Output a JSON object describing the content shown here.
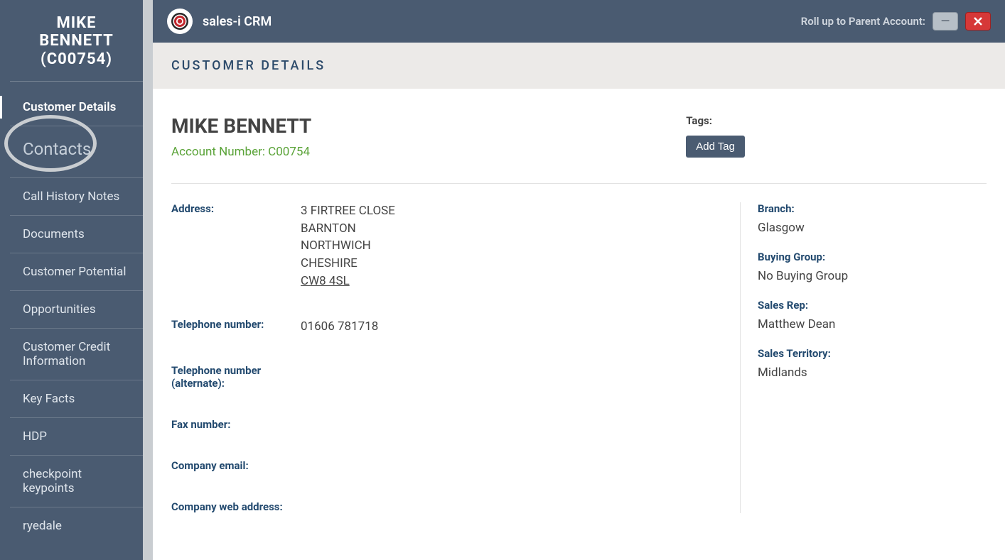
{
  "sidebar": {
    "title_line1": "MIKE",
    "title_line2": "BENNETT",
    "title_line3": "(C00754)",
    "items": [
      {
        "label": "Customer Details"
      },
      {
        "label": "Contacts"
      },
      {
        "label": "Call History Notes"
      },
      {
        "label": "Documents"
      },
      {
        "label": "Customer Potential"
      },
      {
        "label": "Opportunities"
      },
      {
        "label": "Customer Credit Information"
      },
      {
        "label": "Key Facts"
      },
      {
        "label": "HDP"
      },
      {
        "label": "checkpoint keypoints"
      },
      {
        "label": "ryedale"
      }
    ]
  },
  "topbar": {
    "app_title": "sales-i CRM",
    "rollup_label": "Roll up to Parent Account:"
  },
  "subheader": "CUSTOMER DETAILS",
  "customer": {
    "name": "MIKE BENNETT",
    "account_number_label": "Account Number: C00754",
    "tags_label": "Tags:",
    "add_tag_label": "Add Tag",
    "fields": {
      "address_label": "Address:",
      "address_line1": "3 FIRTREE CLOSE",
      "address_line2": "BARNTON",
      "address_line3": "NORTHWICH",
      "address_line4": "CHESHIRE",
      "address_postal": "CW8 4SL",
      "phone_label": "Telephone number:",
      "phone_value": "01606 781718",
      "phone_alt_label": "Telephone number (alternate):",
      "phone_alt_value": "",
      "fax_label": "Fax number:",
      "fax_value": "",
      "email_label": "Company email:",
      "email_value": "",
      "web_label": "Company web address:",
      "web_value": ""
    },
    "right": {
      "branch_label": "Branch:",
      "branch_value": "Glasgow",
      "buying_group_label": "Buying Group:",
      "buying_group_value": "No Buying Group",
      "sales_rep_label": "Sales Rep:",
      "sales_rep_value": "Matthew Dean",
      "territory_label": "Sales Territory:",
      "territory_value": "Midlands"
    }
  }
}
